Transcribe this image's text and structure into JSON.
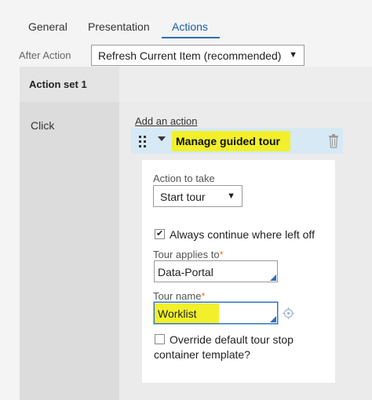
{
  "tabs": [
    {
      "label": "General"
    },
    {
      "label": "Presentation"
    },
    {
      "label": "Actions",
      "active": true
    }
  ],
  "after_action": {
    "label": "After Action",
    "selected": "Refresh Current Item (recommended)"
  },
  "action_set": {
    "title": "Action set 1",
    "event": "Click",
    "add_action_link": "Add an action",
    "action": {
      "name": "Manage guided tour",
      "action_to_take_label": "Action to take",
      "action_to_take_value": "Start tour",
      "always_continue_label": "Always continue where left off",
      "always_continue_checked": true,
      "tour_applies_to_label": "Tour applies to",
      "tour_applies_to_value": "Data-Portal",
      "tour_name_label": "Tour name",
      "tour_name_value": "Worklist",
      "required_marker": "*",
      "override_label_line1": "Override default tour stop",
      "override_label_line2": "container template?",
      "override_checked": false
    }
  },
  "icons": [
    "drag-handle-icon",
    "collapse-caret-icon",
    "trash-icon",
    "target-icon",
    "dropdown-arrow-icon"
  ],
  "colors": {
    "accent": "#2f6fb5",
    "highlight": "#f2f02a",
    "required": "#e07c1c",
    "action_bar": "#d6e9f5"
  }
}
